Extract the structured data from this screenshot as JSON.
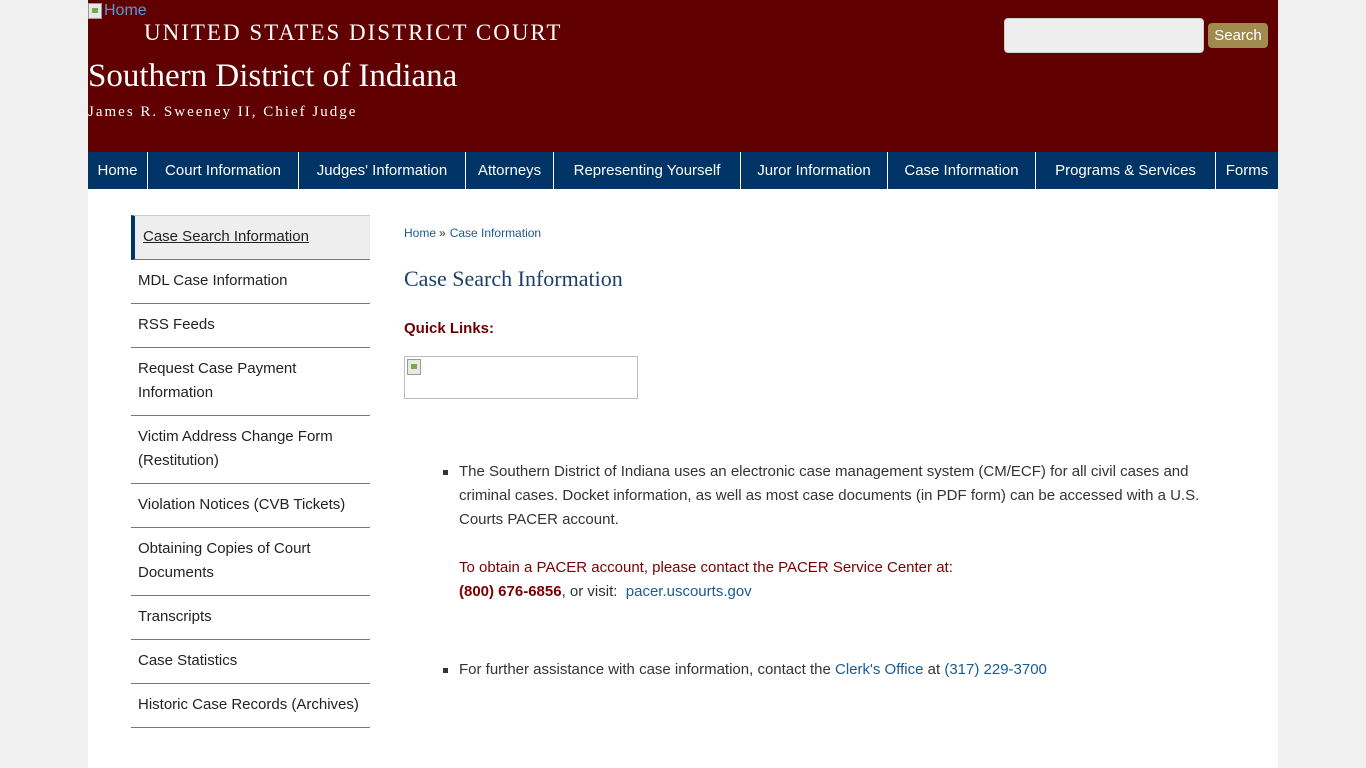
{
  "header": {
    "home_alt": "Home",
    "court_name": "UNITED STATES DISTRICT COURT",
    "district": "Southern District of Indiana",
    "chief_judge": "James R. Sweeney II, Chief Judge",
    "search_value": "",
    "search_button": "Search"
  },
  "nav": {
    "items": [
      {
        "label": "Home"
      },
      {
        "label": "Court Information"
      },
      {
        "label": "Judges' Information"
      },
      {
        "label": "Attorneys"
      },
      {
        "label": "Representing Yourself"
      },
      {
        "label": "Juror Information"
      },
      {
        "label": "Case Information"
      },
      {
        "label": "Programs & Services"
      },
      {
        "label": "Forms"
      }
    ]
  },
  "sidebar": {
    "items": [
      {
        "label": "Case Search Information",
        "active": true
      },
      {
        "label": "MDL Case Information"
      },
      {
        "label": "RSS Feeds"
      },
      {
        "label": "Request Case Payment Information"
      },
      {
        "label": "Victim Address Change Form (Restitution)"
      },
      {
        "label": "Violation Notices (CVB Tickets)"
      },
      {
        "label": "Obtaining Copies of Court Documents"
      },
      {
        "label": "Transcripts"
      },
      {
        "label": "Case Statistics"
      },
      {
        "label": "Historic Case Records (Archives)"
      }
    ]
  },
  "breadcrumb": {
    "home": "Home",
    "separator": "»",
    "current": "Case Information"
  },
  "main": {
    "title": "Case Search Information",
    "quick_links_label": "Quick Links:",
    "bullet1": {
      "text": "The Southern District of Indiana uses an electronic case management system (CM/ECF) for all civil cases and criminal cases. Docket information, as well as most case documents (in PDF form) can be accessed with a U.S. Courts PACER account.",
      "pacer_intro": "To obtain a PACER account, please contact the PACER Service Center at:",
      "pacer_phone": "(800) 676-6856",
      "or_visit": ", or visit: ",
      "pacer_link": "pacer.uscourts.gov"
    },
    "bullet2": {
      "prefix": "For further assistance with case information, contact the ",
      "clerk_link": "Clerk's Office",
      "at": " at ",
      "clerk_phone": "(317) 229-3700"
    }
  },
  "colors": {
    "header_bg": "#600000",
    "nav_bg": "#003366",
    "search_button_bg": "#a08a4e",
    "link": "#1a5a96",
    "accent_red": "#700000"
  }
}
